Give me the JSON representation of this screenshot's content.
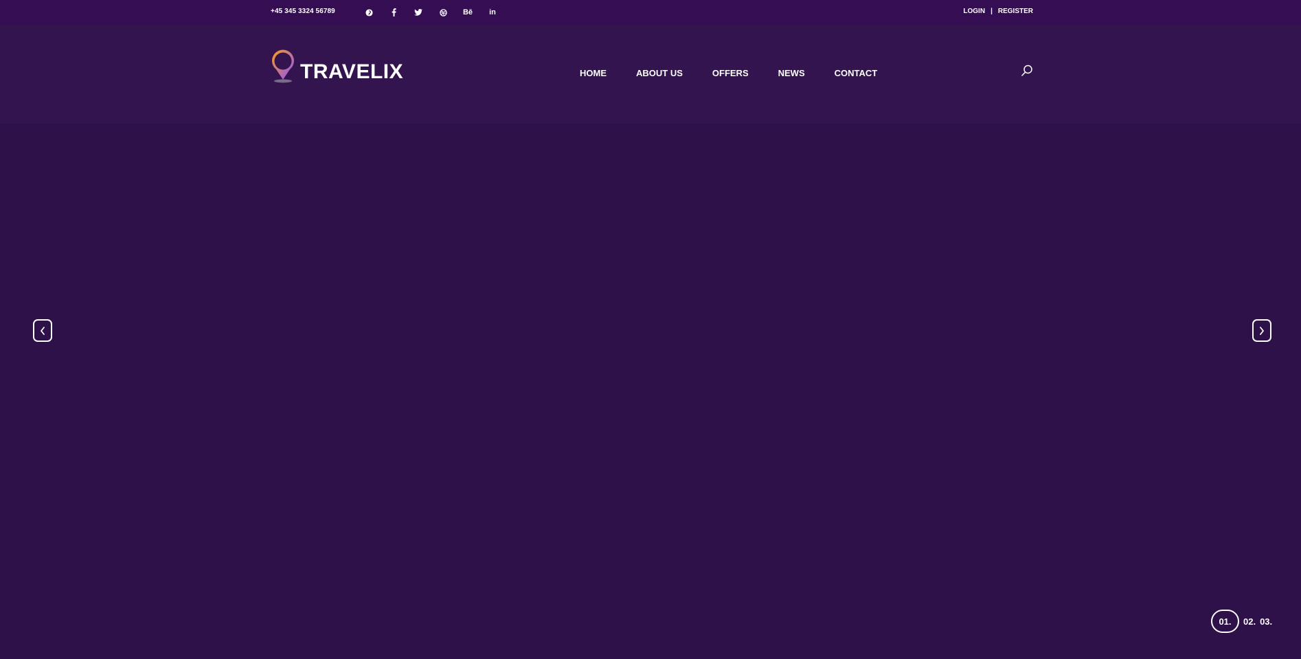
{
  "topbar": {
    "phone": "+45 345 3324 56789",
    "socials": [
      {
        "icon": "pinterest-icon",
        "glyph": ""
      },
      {
        "icon": "facebook-icon",
        "glyph": ""
      },
      {
        "icon": "twitter-icon",
        "glyph": ""
      },
      {
        "icon": "dribbble-icon",
        "glyph": ""
      },
      {
        "icon": "behance-icon",
        "glyph": "Bē"
      },
      {
        "icon": "linkedin-icon",
        "glyph": "in"
      }
    ],
    "login": "LOGIN",
    "separator": "|",
    "register": "REGISTER"
  },
  "header": {
    "logo_text": "TRAVELIX",
    "nav": [
      "HOME",
      "ABOUT US",
      "OFFERS",
      "NEWS",
      "CONTACT"
    ],
    "search_icon": "search-icon"
  },
  "slider": {
    "prev_icon": "chevron-left-icon",
    "next_icon": "chevron-right-icon",
    "pages": [
      "01.",
      "02.",
      "03."
    ],
    "active_page": "01."
  },
  "colors": {
    "background": "#2f1149",
    "topbar": "#350d52",
    "logo_orange": "#fa9e1b",
    "logo_purple": "#8d4fff"
  }
}
